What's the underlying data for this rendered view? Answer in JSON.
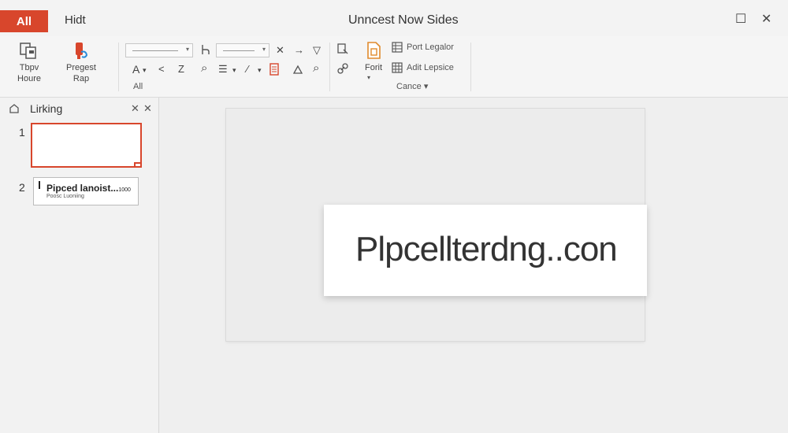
{
  "tabs": {
    "active": "All",
    "second": "Hidt"
  },
  "window": {
    "title": "Unncest Now Sides",
    "maximize": "☐",
    "close": "✕"
  },
  "ribbon": {
    "btn1": {
      "line1": "Tbpv",
      "line2": "Houre"
    },
    "btn2": {
      "line1": "Pregest",
      "line2": "Rap"
    },
    "all_label": "All",
    "font_label": "Forit",
    "cance_label": "Cance ▾",
    "row1_a": "Port Legalor",
    "row1_b": "Adit Lepsice",
    "glyphs": {
      "a": "A",
      "a_arrow": "▾",
      "lt": "<",
      "z": "Z",
      "search": "⌕",
      "list": "☰",
      "list_arrow": "▾",
      "pen": "⁄",
      "pen_arrow": "▾",
      "x": "✕",
      "arrow": "→",
      "filter": "▽",
      "l": "Լ"
    }
  },
  "pane": {
    "title": "Lirking",
    "close1": "✕",
    "close2": "✕",
    "slides": [
      {
        "num": "1"
      },
      {
        "num": "2",
        "title": "Pipced lanoist...",
        "suffix": "1000",
        "sub": "Poosc Luoniing"
      }
    ]
  },
  "slide": {
    "text": "Plpcellterdng..con"
  },
  "colors": {
    "accent": "#d8462c"
  }
}
